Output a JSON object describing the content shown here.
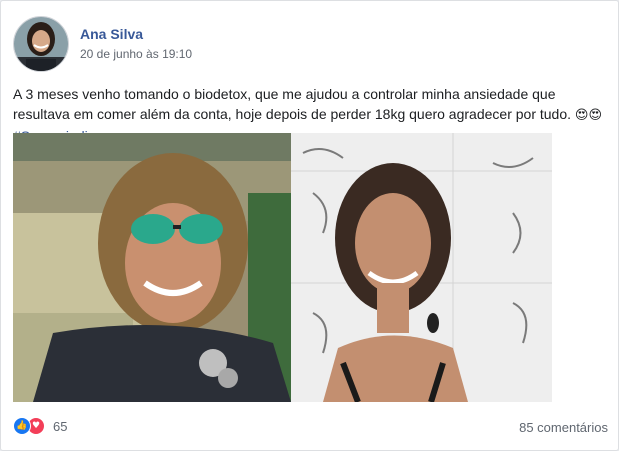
{
  "post": {
    "author": "Ana Silva",
    "timestamp": "20 de junho às 19:10",
    "text": "A 3 meses venho tomando o biodetox, que me ajudou a controlar minha ansiedade que resultava em comer além da conta, hoje depois de perder 18kg quero agradecer por tudo.",
    "emojis": "😍😍",
    "hashtag": "#Super_indico"
  },
  "reactions": {
    "icons": [
      "like-icon",
      "love-icon"
    ],
    "count": "65"
  },
  "comments": {
    "label": "85 comentários"
  },
  "colors": {
    "link": "#385898",
    "like": "#1877f2",
    "love": "#f33e58",
    "meta": "#606770"
  }
}
